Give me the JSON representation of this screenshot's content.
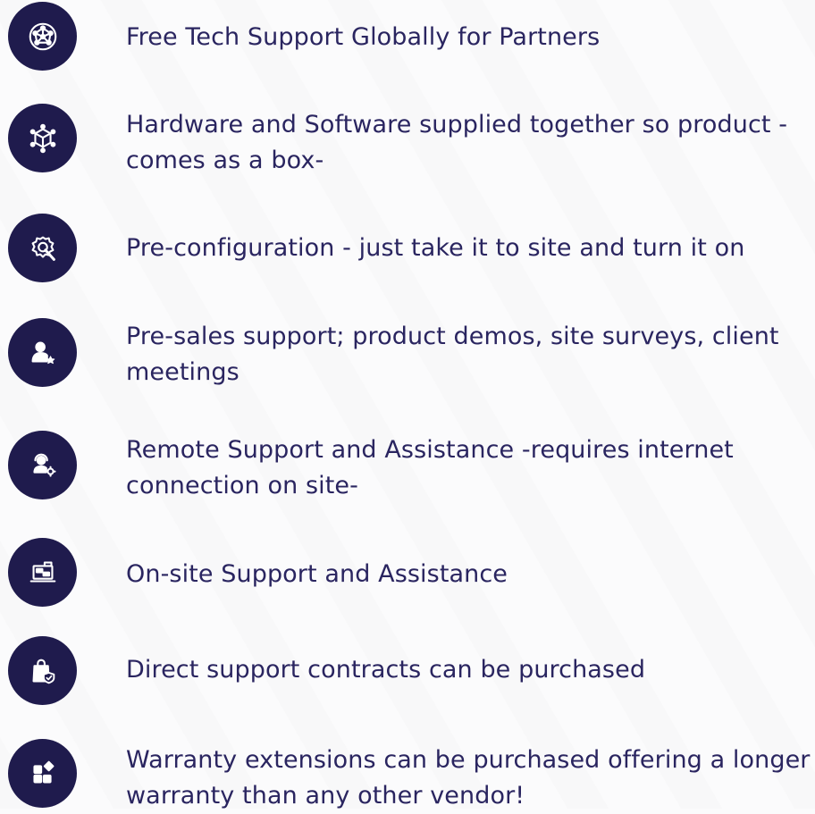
{
  "features": [
    {
      "text": "Free Tech Support Globally for Partners",
      "icon": "network-globe-icon"
    },
    {
      "text": "Hardware and Software supplied together so product -comes as a box-",
      "icon": "cube-network-icon"
    },
    {
      "text": "Pre-configuration - just take it to site and turn it on",
      "icon": "gear-wrench-icon"
    },
    {
      "text": "Pre-sales support; product demos, site surveys, client meetings",
      "icon": "user-star-icon"
    },
    {
      "text": "Remote Support and Assistance -requires internet connection on site-",
      "icon": "headset-agent-icon"
    },
    {
      "text": "On-site Support and Assistance",
      "icon": "laptop-chat-icon"
    },
    {
      "text": "Direct support contracts can be purchased",
      "icon": "shopping-bag-shield-icon"
    },
    {
      "text": "Warranty extensions can be purchased offering a longer warranty than any other vendor!",
      "icon": "apps-grid-icon"
    }
  ],
  "colors": {
    "icon_bg": "#1f1b4d",
    "text": "#2a2560",
    "page_bg": "#fbfbfc"
  }
}
